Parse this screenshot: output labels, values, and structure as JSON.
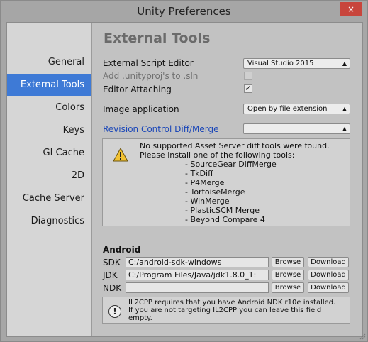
{
  "window": {
    "title": "Unity Preferences",
    "close_glyph": "×"
  },
  "sidebar": {
    "items": [
      {
        "label": "General"
      },
      {
        "label": "External Tools"
      },
      {
        "label": "Colors"
      },
      {
        "label": "Keys"
      },
      {
        "label": "GI Cache"
      },
      {
        "label": "2D"
      },
      {
        "label": "Cache Server"
      },
      {
        "label": "Diagnostics"
      }
    ],
    "active_index": 1
  },
  "main": {
    "heading": "External Tools",
    "script_editor": {
      "label": "External Script Editor",
      "value": "Visual Studio 2015"
    },
    "unityproj": {
      "label": "Add .unityproj's to .sln",
      "checked": false,
      "disabled": true
    },
    "editor_attaching": {
      "label": "Editor Attaching",
      "checked": true,
      "check_glyph": "✓"
    },
    "image_app": {
      "label": "Image application",
      "value": "Open by file extension"
    },
    "revision": {
      "label": "Revision Control Diff/Merge",
      "value": ""
    },
    "diff_help": {
      "line1": "No supported Asset Server diff tools were found.",
      "line2": "Please install one of the following tools:",
      "tools": [
        "- SourceGear DiffMerge",
        "- TkDiff",
        "- P4Merge",
        "- TortoiseMerge",
        "- WinMerge",
        "- PlasticSCM Merge",
        "- Beyond Compare 4"
      ]
    },
    "android": {
      "heading": "Android",
      "rows": [
        {
          "label": "SDK",
          "value": "C:/android-sdk-windows",
          "browse": "Browse",
          "download": "Download"
        },
        {
          "label": "JDK",
          "value": "C:/Program Files/Java/jdk1.8.0_1:",
          "browse": "Browse",
          "download": "Download"
        },
        {
          "label": "NDK",
          "value": "",
          "browse": "Browse",
          "download": "Download"
        }
      ],
      "info": {
        "line1": "IL2CPP requires that you have Android NDK r10e installed.",
        "line2": "If you are not targeting IL2CPP you can leave this field",
        "line3": "empty."
      }
    }
  },
  "colors": {
    "selection": "#3e7ad6",
    "link_label": "#1b47b8",
    "close_button": "#c8453c"
  },
  "icons": {
    "warning": "warning-icon",
    "info": "info-icon",
    "dropdown": "dropdown-arrow-icon"
  }
}
